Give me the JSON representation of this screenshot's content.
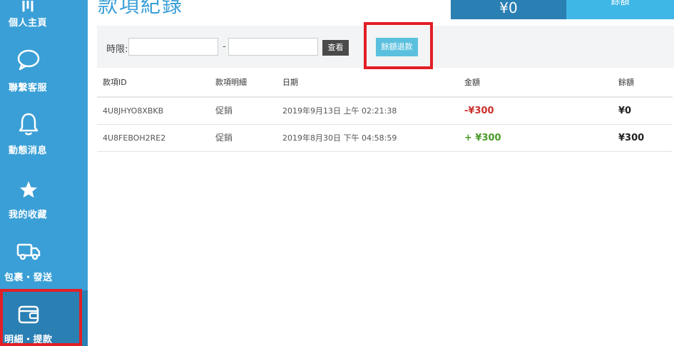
{
  "sidebar": {
    "items": [
      {
        "label": "個人主頁",
        "icon": "home-icon"
      },
      {
        "label": "聯繫客服",
        "icon": "chat-bubble-icon"
      },
      {
        "label": "動態消息",
        "icon": "bell-icon"
      },
      {
        "label": "我的收藏",
        "icon": "star-icon"
      },
      {
        "label": "包裹・發送",
        "icon": "truck-icon"
      },
      {
        "label": "明細・提款",
        "icon": "wallet-icon"
      }
    ],
    "active_index": 5
  },
  "header": {
    "title": "款項紀錄",
    "balance": "¥0",
    "balance_button": "餘額"
  },
  "filter": {
    "label": "時限:",
    "separator": "-",
    "start_value": "",
    "end_value": "",
    "search_button": "查看",
    "refund_button": "餘額退款"
  },
  "table": {
    "columns": {
      "id": "款項ID",
      "type": "款項明細",
      "date": "日期",
      "amount": "金額",
      "balance": "餘額"
    },
    "rows": [
      {
        "id": "4U8JHYO8XBKB",
        "type": "促銷",
        "date": "2019年9月13日 上午 02:21:38",
        "amount": "-¥300",
        "balance": "¥0"
      },
      {
        "id": "4U8FEBOH2RE2",
        "type": "促銷",
        "date": "2019年8月30日 下午 04:58:59",
        "amount": "+ ¥300",
        "balance": "¥300"
      }
    ]
  },
  "colors": {
    "sidebar": "#3a9fd6",
    "accent": "#3fb7e6",
    "negative": "#c9302c",
    "positive": "#4a9a27",
    "highlight": "#e21f26"
  }
}
